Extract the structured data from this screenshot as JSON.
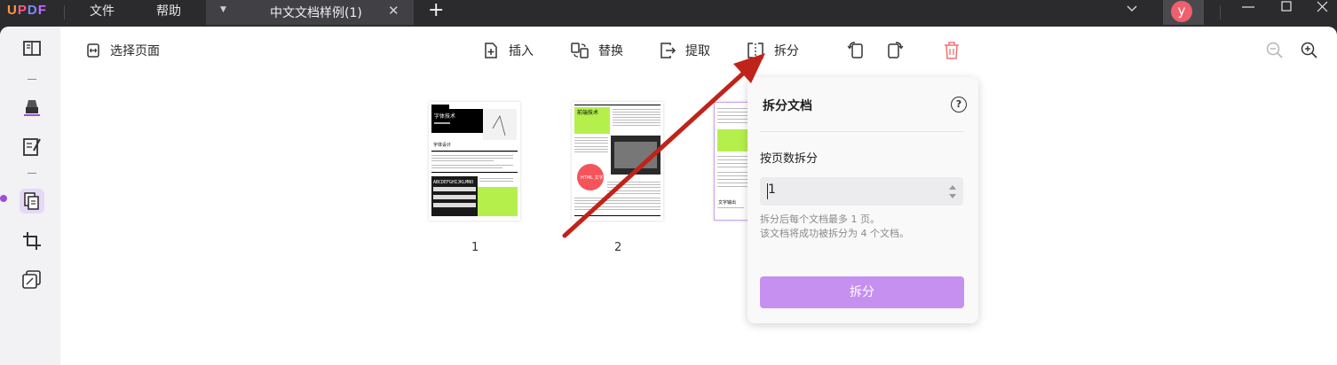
{
  "titlebar": {
    "logo": "UPDF",
    "menus": [
      "文件",
      "帮助"
    ],
    "tab_title": "中文文档样例(1)",
    "avatar_letter": "y"
  },
  "toolbar": {
    "select_pages": "选择页面",
    "insert": "插入",
    "replace": "替换",
    "extract": "提取",
    "split": "拆分"
  },
  "pages": [
    {
      "number": "1"
    },
    {
      "number": "2"
    }
  ],
  "thumb1": {
    "title": "字体技术",
    "subtitle": "字体设计",
    "line": "ABCDEFGHIJKLMNO"
  },
  "thumb2": {
    "heading": "前端技术",
    "badge": "HTML 文字"
  },
  "thumb3": {
    "heading": "文字输出"
  },
  "split_panel": {
    "title": "拆分文档",
    "help": "?",
    "label": "按页数拆分",
    "value": "1",
    "info_line1": "拆分后每个文档最多 1 页。",
    "info_line2": "该文档将成功被拆分为 4 个文档。",
    "button": "拆分"
  },
  "colors": {
    "accent": "#c690f1",
    "active_sidebar": "#e6d9f7",
    "annotation_arrow": "#c0231a",
    "titlebar_bg": "#2b2b2e"
  }
}
